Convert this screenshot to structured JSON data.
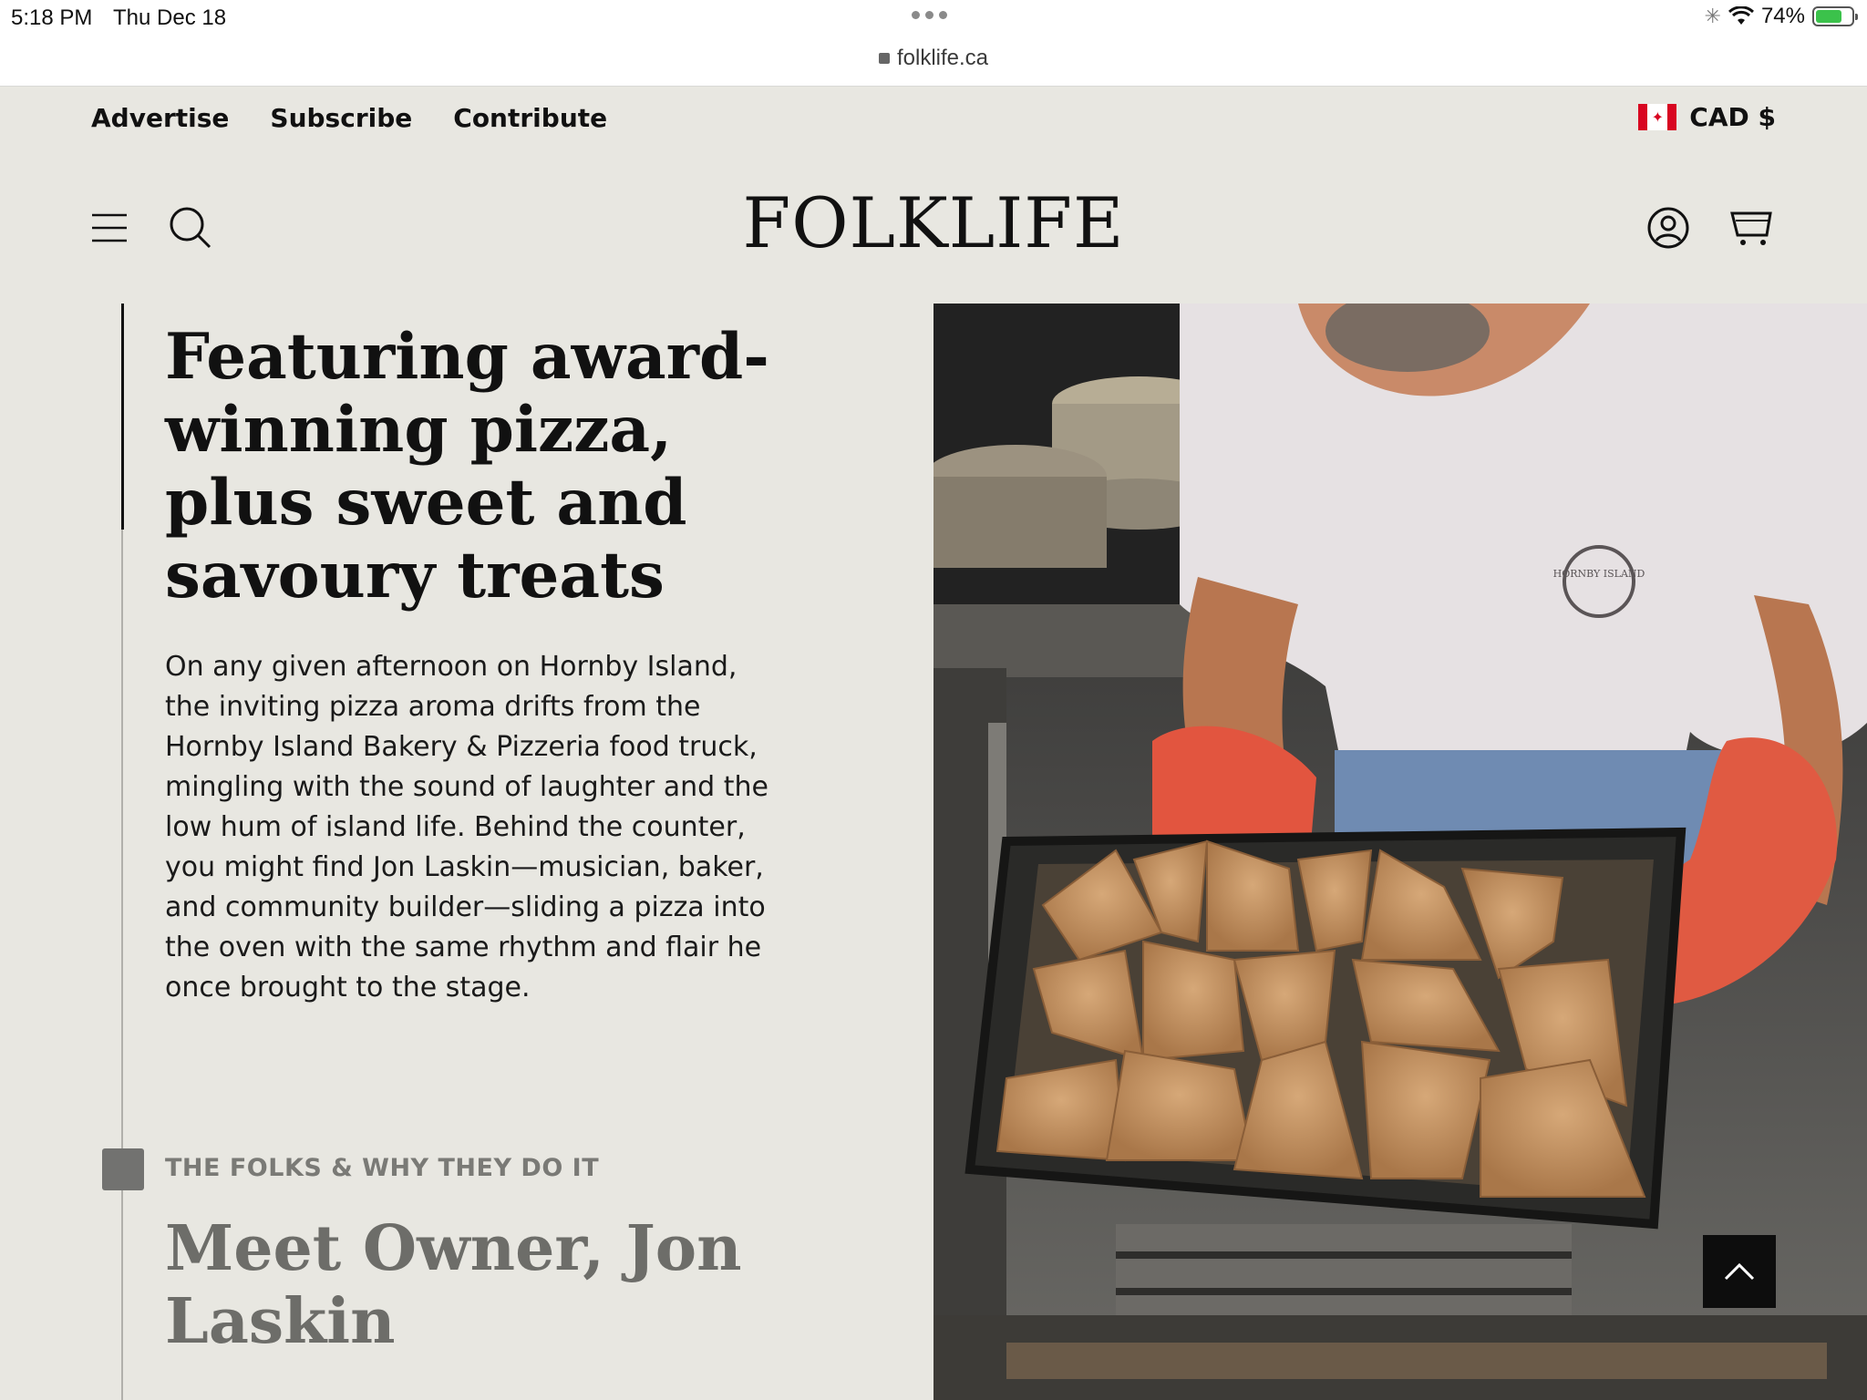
{
  "status_bar": {
    "time": "5:18 PM",
    "date": "Thu Dec 18",
    "battery": "74%",
    "url": "folklife.ca"
  },
  "utility_nav": [
    "Advertise",
    "Subscribe",
    "Contribute"
  ],
  "currency": "CAD $",
  "logo": "FOLKLIFE",
  "article": {
    "headline": "Featuring award-winning pizza, plus sweet and savoury treats",
    "body": "On any given afternoon on Hornby Island, the inviting pizza aroma drifts from the Hornby Island Bakery & Pizzeria food truck, mingling with the sound of laughter and the low hum of island life. Behind the counter, you might find Jon Laskin—musician, baker, and community builder—sliding a pizza into the oven with the same rhythm and flair he once brought to the stage."
  },
  "next_section": {
    "kicker": "THE FOLKS & WHY THEY DO IT",
    "title": "Meet Owner, Jon Laskin"
  },
  "photo": {
    "shirt_text": "HORNBY ISLAND"
  },
  "colors": {
    "page_bg": "#e8e7e1",
    "text": "#111111",
    "muted": "#6d6d69",
    "mitt": "#e2553f"
  }
}
